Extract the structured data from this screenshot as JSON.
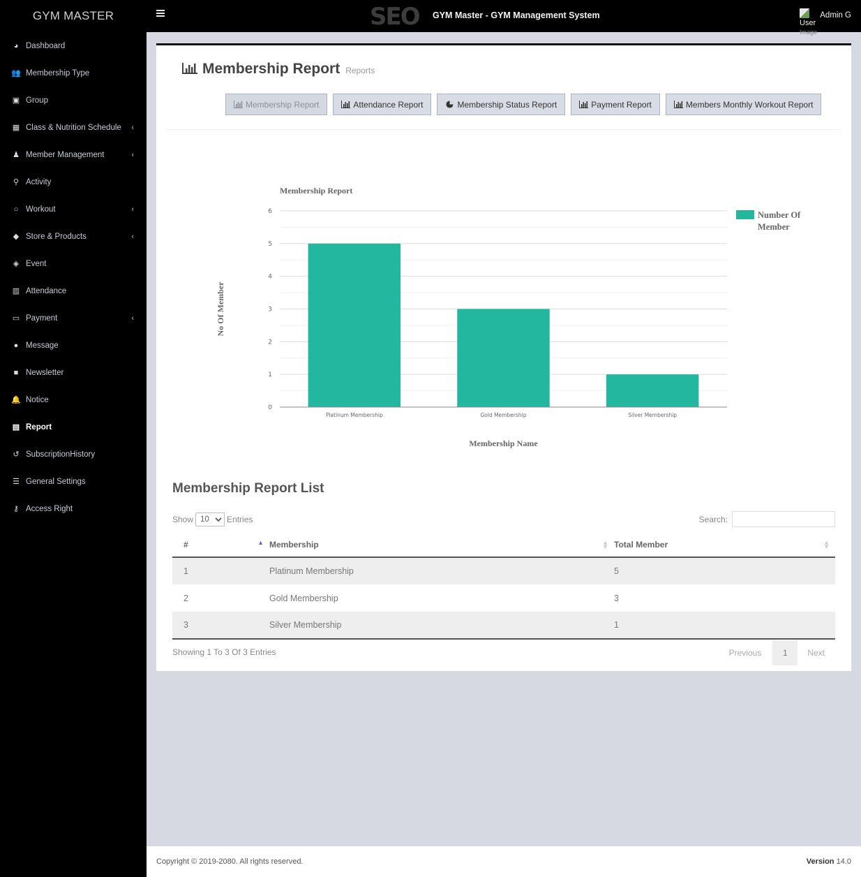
{
  "brand": "GYM MASTER",
  "topbar": {
    "logo_text": "SEO",
    "app_title": "GYM Master - GYM Management System",
    "user_image_alt_line1": "User",
    "user_image_alt_line2": "Image",
    "user_name": "Admin G"
  },
  "sidebar": {
    "items": [
      {
        "label": "Dashboard",
        "icon": "dashboard-icon",
        "glyph": "◕",
        "chevron": false
      },
      {
        "label": "Membership Type",
        "icon": "users-icon",
        "glyph": "👥",
        "chevron": false
      },
      {
        "label": "Group",
        "icon": "group-icon",
        "glyph": "▣",
        "chevron": false
      },
      {
        "label": "Class & Nutrition Schedule",
        "icon": "calendar-icon",
        "glyph": "▦",
        "chevron": true
      },
      {
        "label": "Member Management",
        "icon": "user-icon",
        "glyph": "♟",
        "chevron": true
      },
      {
        "label": "Activity",
        "icon": "bicycle-icon",
        "glyph": "⚲",
        "chevron": false
      },
      {
        "label": "Workout",
        "icon": "workout-icon",
        "glyph": "○",
        "chevron": true
      },
      {
        "label": "Store & Products",
        "icon": "tags-icon",
        "glyph": "◆",
        "chevron": true
      },
      {
        "label": "Event",
        "icon": "ticket-icon",
        "glyph": "◈",
        "chevron": false
      },
      {
        "label": "Attendance",
        "icon": "attendance-icon",
        "glyph": "▥",
        "chevron": false
      },
      {
        "label": "Payment",
        "icon": "money-icon",
        "glyph": "▭",
        "chevron": true
      },
      {
        "label": "Message",
        "icon": "comment-icon",
        "glyph": "●",
        "chevron": false
      },
      {
        "label": "Newsletter",
        "icon": "newsletter-icon",
        "glyph": "■",
        "chevron": false
      },
      {
        "label": "Notice",
        "icon": "bell-icon",
        "glyph": "🔔",
        "chevron": false
      },
      {
        "label": "Report",
        "icon": "report-icon",
        "glyph": "▤",
        "chevron": false,
        "active": true
      },
      {
        "label": "SubscriptionHistory",
        "icon": "history-icon",
        "glyph": "↺",
        "chevron": false
      },
      {
        "label": "General Settings",
        "icon": "sliders-icon",
        "glyph": "☰",
        "chevron": false
      },
      {
        "label": "Access Right",
        "icon": "key-icon",
        "glyph": "⚷",
        "chevron": false
      }
    ],
    "chevron_glyph": "‹"
  },
  "page": {
    "title": "Membership Report",
    "subtitle": "Reports"
  },
  "report_buttons": [
    {
      "label": "Membership Report",
      "icon": "bar-chart-icon",
      "active": true
    },
    {
      "label": "Attendance Report",
      "icon": "bar-chart-icon",
      "active": false
    },
    {
      "label": "Membership Status Report",
      "icon": "pie-chart-icon",
      "active": false
    },
    {
      "label": "Payment Report",
      "icon": "bar-chart-icon",
      "active": false
    },
    {
      "label": "Members Monthly Workout Report",
      "icon": "bar-chart-icon",
      "active": false
    }
  ],
  "chart_data": {
    "type": "bar",
    "title": "Membership Report",
    "categories": [
      "Platinum Membership",
      "Gold Membership",
      "Silver Membership"
    ],
    "series": [
      {
        "name": "Number Of Member",
        "values": [
          5,
          3,
          1
        ],
        "color": "#24b79f"
      }
    ],
    "xlabel": "Membership Name",
    "ylabel": "No Of Member",
    "ylim": [
      0,
      6
    ],
    "yticks": [
      0,
      1,
      2,
      3,
      4,
      5,
      6
    ],
    "grid": true,
    "legend": "top-right",
    "legend_lines": [
      "Number Of",
      "Member"
    ]
  },
  "table": {
    "title": "Membership Report List",
    "show_label": "Show",
    "entries_label": "Entries",
    "page_length": "10",
    "search_label": "Search:",
    "search_value": "",
    "columns": [
      "#",
      "Membership",
      "Total Member"
    ],
    "rows": [
      [
        "1",
        "Platinum Membership",
        "5"
      ],
      [
        "2",
        "Gold Membership",
        "3"
      ],
      [
        "3",
        "Silver Membership",
        "1"
      ]
    ],
    "info": "Showing 1 To 3 Of 3 Entries",
    "pagination": {
      "previous": "Previous",
      "current": "1",
      "next": "Next"
    }
  },
  "footer": {
    "copyright": "Copyright © 2019-2080. All rights reserved.",
    "version_label": "Version",
    "version_value": "14.0"
  }
}
